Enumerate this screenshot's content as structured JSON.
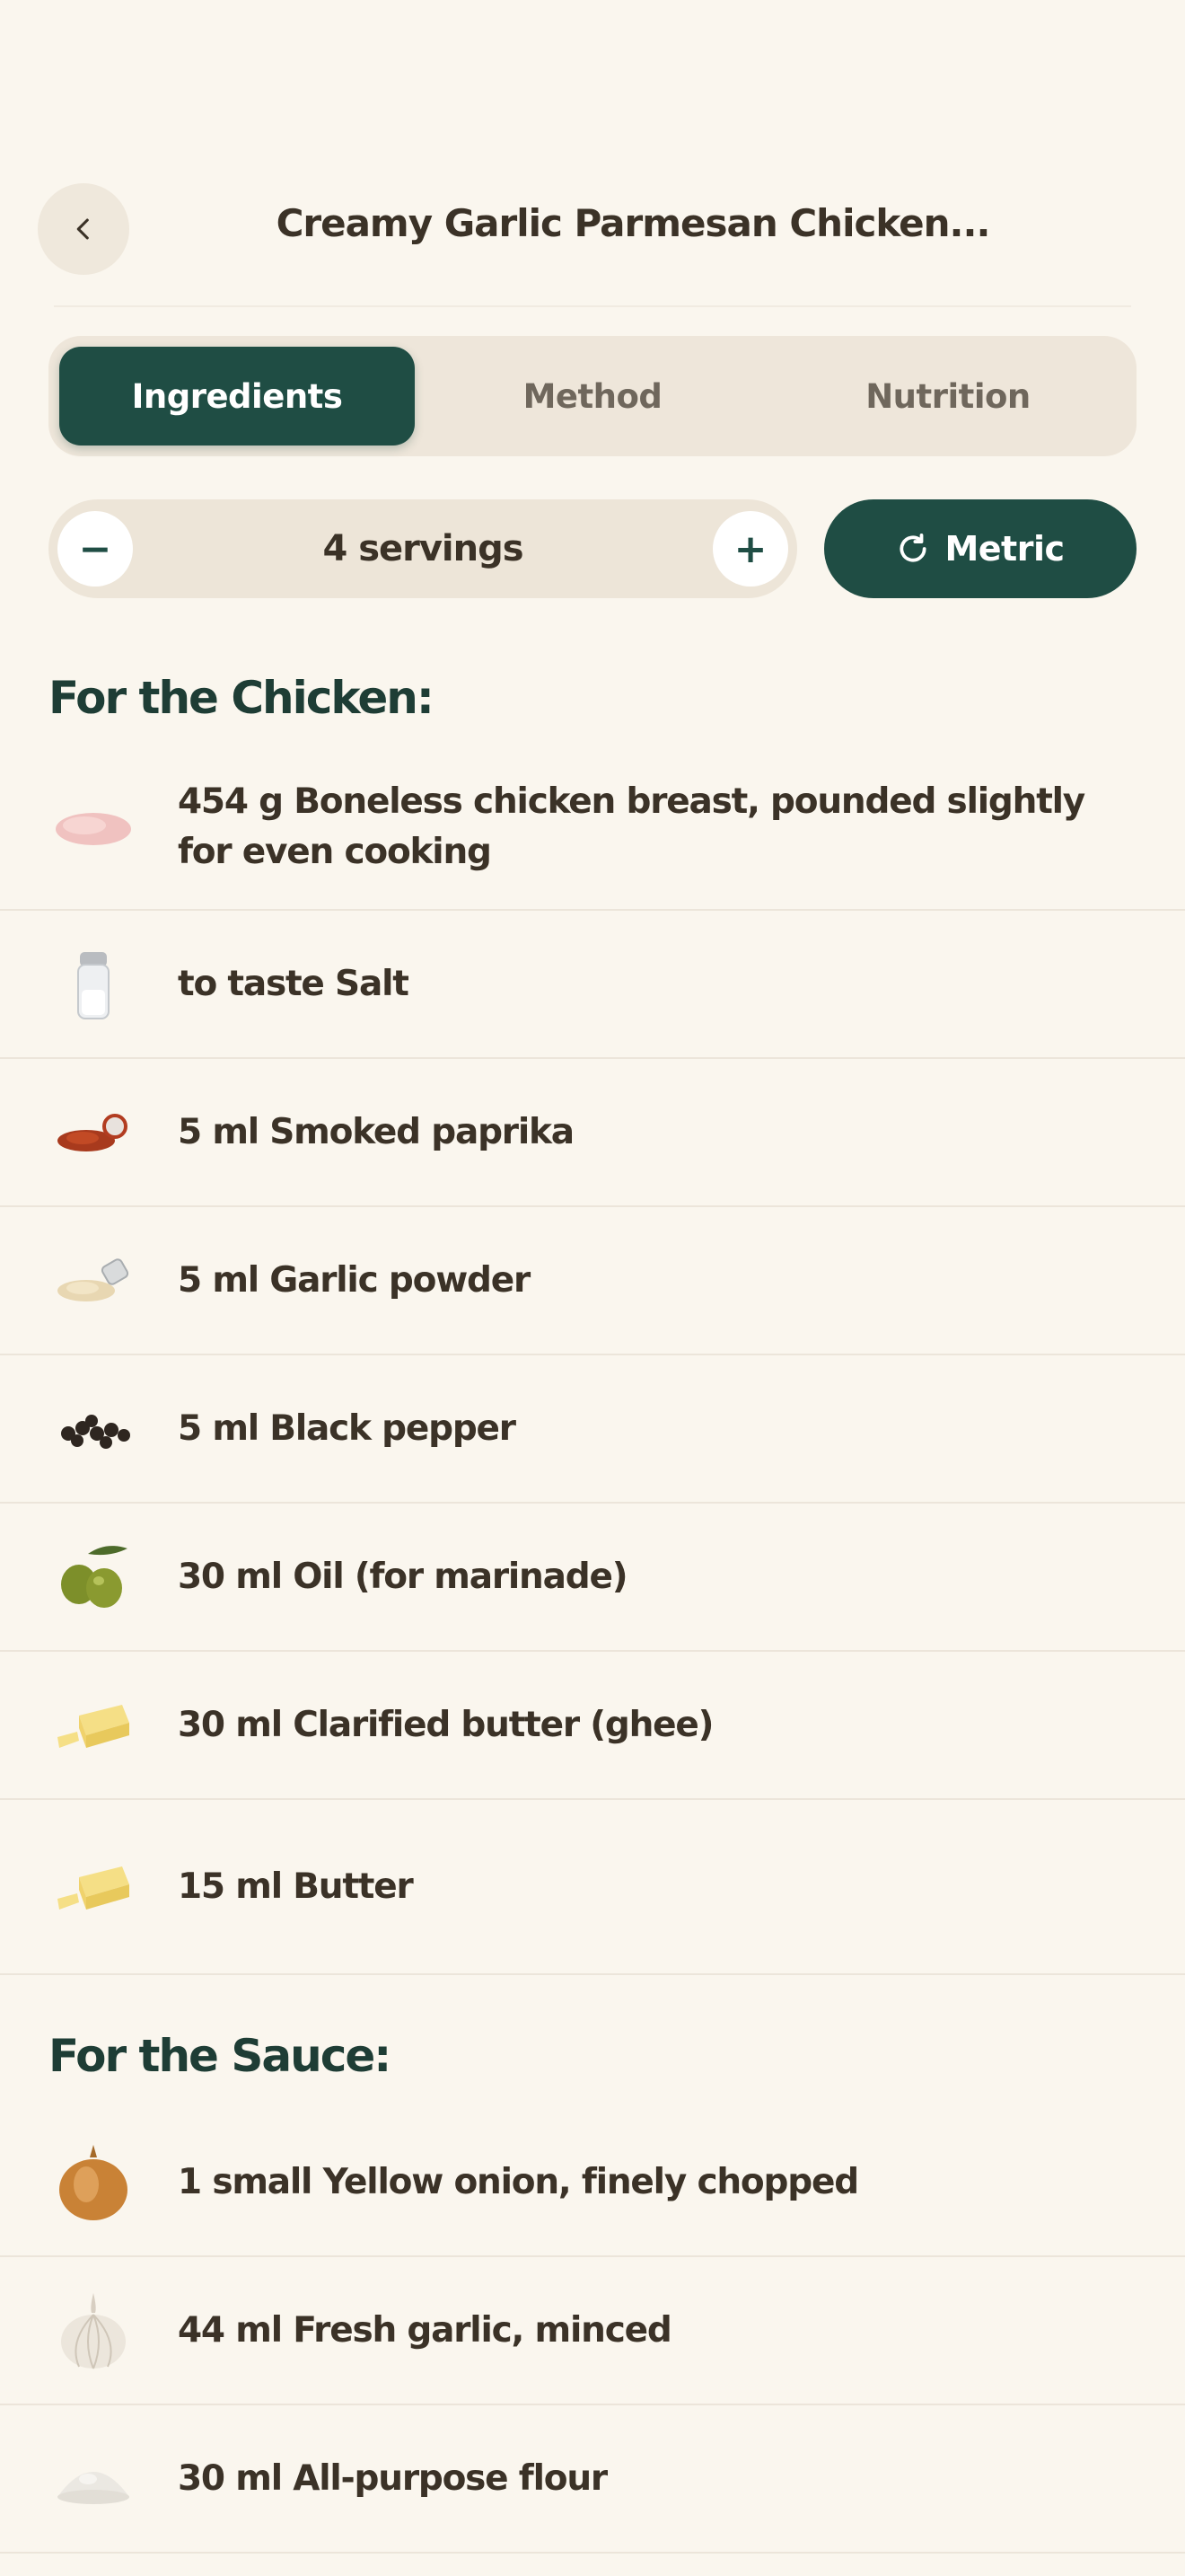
{
  "header": {
    "title": "Creamy Garlic Parmesan Chicken..."
  },
  "tabs": [
    {
      "label": "Ingredients",
      "active": true
    },
    {
      "label": "Method",
      "active": false
    },
    {
      "label": "Nutrition",
      "active": false
    }
  ],
  "servings": {
    "minus": "−",
    "plus": "+",
    "label": "4 servings"
  },
  "units": {
    "label": "Metric"
  },
  "sections": [
    {
      "title": "For the Chicken:",
      "items": [
        {
          "text": "454 g Boneless chicken breast, pounded slightly for even cooking",
          "icon": "chicken-breast-icon"
        },
        {
          "text": "to taste Salt",
          "icon": "salt-shaker-icon"
        },
        {
          "text": "5 ml Smoked paprika",
          "icon": "paprika-icon"
        },
        {
          "text": "5 ml Garlic powder",
          "icon": "garlic-powder-icon"
        },
        {
          "text": "5 ml Black pepper",
          "icon": "black-pepper-icon"
        },
        {
          "text": "30 ml Oil (for marinade)",
          "icon": "olives-icon"
        },
        {
          "text": "30 ml Clarified butter (ghee)",
          "icon": "butter-icon"
        },
        {
          "text": "15 ml Butter",
          "icon": "butter-icon"
        }
      ]
    },
    {
      "title": "For the Sauce:",
      "items": [
        {
          "text": "1 small Yellow onion, finely chopped",
          "icon": "onion-icon"
        },
        {
          "text": "44 ml Fresh garlic, minced",
          "icon": "garlic-bulb-icon"
        },
        {
          "text": "30 ml All-purpose flour",
          "icon": "flour-icon"
        }
      ]
    }
  ],
  "colors": {
    "background": "#faf6ee",
    "accent": "#1f4d44",
    "text": "#3b3227"
  }
}
